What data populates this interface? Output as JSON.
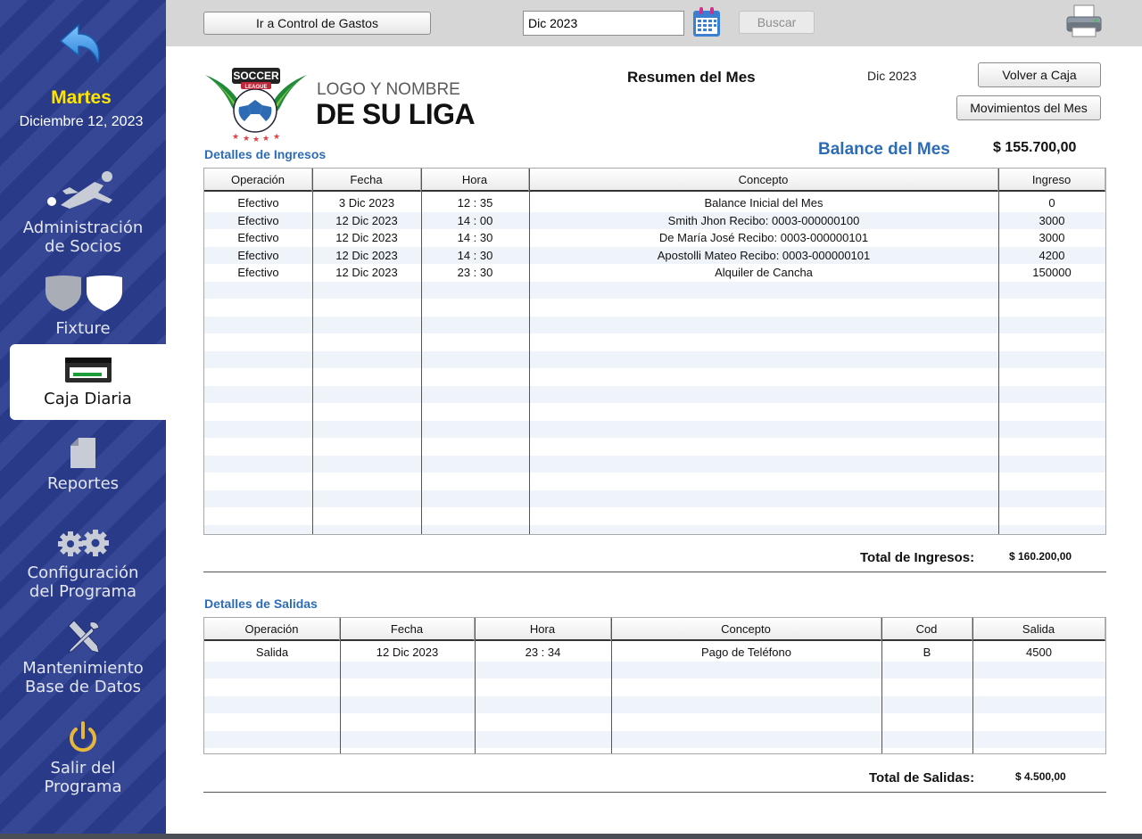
{
  "sidebar": {
    "day_name": "Martes",
    "date": "Diciembre 12, 2023",
    "items": [
      {
        "label_1": "Administración",
        "label_2": "de Socios",
        "icon": "soccer-player-icon"
      },
      {
        "label_1": "Fixture",
        "label_2": "",
        "icon": "shields-icon"
      },
      {
        "label_1": "Caja Diaria",
        "label_2": "",
        "icon": "cash-register-icon",
        "active": true
      },
      {
        "label_1": "Reportes",
        "label_2": "",
        "icon": "document-icon"
      },
      {
        "label_1": "Configuración",
        "label_2": "del Programa",
        "icon": "gears-icon"
      },
      {
        "label_1": "Mantenimiento",
        "label_2": "Base de Datos",
        "icon": "tools-icon"
      },
      {
        "label_1": "Salir del",
        "label_2": "Programa",
        "icon": "power-icon"
      }
    ]
  },
  "topbar": {
    "gastos_button": "Ir a Control de Gastos",
    "month_value": "Dic 2023",
    "search_button": "Buscar"
  },
  "header": {
    "logo_line1": "LOGO Y NOMBRE",
    "logo_line2": "DE SU LIGA",
    "logo_badge": "SOCCER",
    "logo_badge_sub": "LEAGUE",
    "title": "Resumen del Mes",
    "month": "Dic 2023",
    "volver_button": "Volver a Caja",
    "movimientos_button": "Movimientos del Mes"
  },
  "balance": {
    "label": "Balance del Mes",
    "value": "$ 155.700,00"
  },
  "ingresos": {
    "title": "Detalles de Ingresos",
    "columns": [
      "Operación",
      "Fecha",
      "Hora",
      "Concepto",
      "Ingreso"
    ],
    "rows": [
      [
        "Efectivo",
        "3 Dic 2023",
        "12 : 35",
        "Balance Inicial del Mes",
        "0"
      ],
      [
        "Efectivo",
        "12 Dic 2023",
        "14 : 00",
        "Smith Jhon Recibo: 0003-000000100",
        "3000"
      ],
      [
        "Efectivo",
        "12 Dic 2023",
        "14 : 30",
        "De María José Recibo: 0003-000000101",
        "3000"
      ],
      [
        "Efectivo",
        "12 Dic 2023",
        "14 : 30",
        "Apostolli Mateo Recibo: 0003-000000101",
        "4200"
      ],
      [
        "Efectivo",
        "12 Dic 2023",
        "23 : 30",
        "Alquiler de Cancha",
        "150000"
      ]
    ],
    "total_label": "Total de Ingresos:",
    "total_value": "$ 160.200,00"
  },
  "salidas": {
    "title": "Detalles de Salidas",
    "columns": [
      "Operación",
      "Fecha",
      "Hora",
      "Concepto",
      "Cod",
      "Salida"
    ],
    "rows": [
      [
        "Salida",
        "12 Dic 2023",
        "23 : 34",
        "Pago de Teléfono",
        "B",
        "4500"
      ]
    ],
    "total_label": "Total de Salidas:",
    "total_value": "$ 4.500,00"
  },
  "colors": {
    "sidebar_bg": "#2a3d8f",
    "accent_blue": "#2d6cb5",
    "day_yellow": "#ffe500",
    "stripe": "#eef4fa"
  }
}
